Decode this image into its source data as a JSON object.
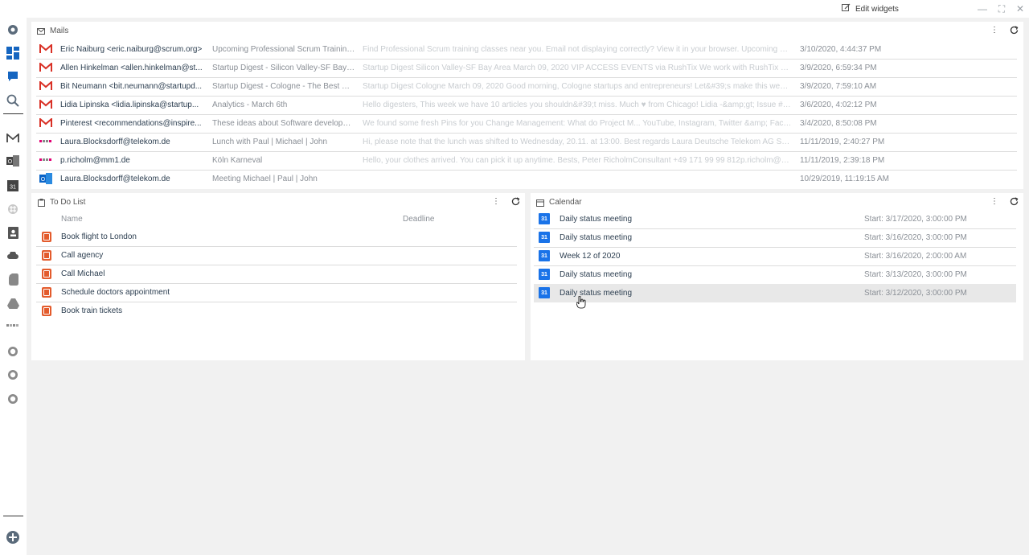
{
  "toolbar": {
    "edit_widgets_label": "Edit widgets"
  },
  "window": {
    "minimize": "—",
    "maximize": "⛶",
    "close": "✕"
  },
  "colors": {
    "accent": "#1565c0",
    "gmail_red": "#d93025",
    "todo_orange": "#e35b2c",
    "calendar_blue": "#1a73e8"
  },
  "sidebar": {
    "top_icons": [
      "gear-icon",
      "dashboard-icon",
      "chat-icon",
      "search-icon"
    ],
    "app_icons": [
      "gmail-icon",
      "outlook-icon",
      "calendar-icon",
      "slack-icon",
      "contacts-icon",
      "cloud-icon",
      "evernote-icon",
      "drive-icon",
      "telekom-icon",
      "whatsapp-icon",
      "whatsapp-icon",
      "whatsapp-icon"
    ],
    "add_icon": "add-icon"
  },
  "mails": {
    "title": "Mails",
    "rows": [
      {
        "icon": "gmail",
        "from": "Eric Naiburg <eric.naiburg@scrum.org>",
        "subject": "Upcoming Professional Scrum Training...",
        "preview": "Find Professional Scrum training classes near you. Email not displaying correctly? View it in your browser. Upcoming Prof...",
        "date": "3/10/2020, 4:44:37 PM"
      },
      {
        "icon": "gmail",
        "from": "Allen Hinkelman <allen.hinkelman@st...",
        "subject": "Startup Digest - Silicon Valley-SF Bay A...",
        "preview": "Startup Digest Silicon Valley-SF Bay Area March 09, 2020 VIP ACCESS EVENTS via RushTix We work with RushTix becau...",
        "date": "3/9/2020, 6:59:34 PM"
      },
      {
        "icon": "gmail",
        "from": "Bit Neumann <bit.neumann@startupd...",
        "subject": "Startup Digest - Cologne - The Best Dig...",
        "preview": "Startup Digest Cologne March 09, 2020 Good morning, Cologne startups and entrepreneurs! Let&#39;s make this week&#...",
        "date": "3/9/2020, 7:59:10 AM"
      },
      {
        "icon": "gmail",
        "from": "Lidia Lipinska <lidia.lipinska@startup...",
        "subject": "Analytics - March 6th",
        "preview": "Hello digesters, This week we have 10 articles you shouldn&#39;t miss. Much ♥ from Chicago! Lidia -&amp;gt; Issue #10...",
        "date": "3/6/2020, 4:02:12 PM"
      },
      {
        "icon": "gmail",
        "from": "Pinterest <recommendations@inspire...",
        "subject": "These ideas about Software developm...",
        "preview": "We found some fresh Pins for you Change Management: What do Project M... YouTube, Instagram, Twitter &amp; Facebo...",
        "date": "3/4/2020, 8:50:08 PM"
      },
      {
        "icon": "telekom",
        "from": "Laura.Blocksdorff@telekom.de",
        "subject": "Lunch with Paul | Michael | John",
        "preview": "Hi, please note that the lunch was shifted to Wednesday, 20.11. at 13:00. Best regards Laura Deutsche Telekom AG Start ...",
        "date": "11/11/2019, 2:40:27 PM"
      },
      {
        "icon": "telekom",
        "from": "p.richolm@mm1.de",
        "subject": "Köln Karneval",
        "preview": "Hello, your clothes arrived. You can pick it up anytime. Bests, Peter RicholmConsultant +49 171 99 99 812p.richolm@mm...",
        "date": "11/11/2019, 2:39:18 PM"
      },
      {
        "icon": "outlook",
        "from": "Laura.Blocksdorff@telekom.de",
        "subject": "Meeting Michael | Paul | John",
        "preview": "",
        "date": "10/29/2019, 11:19:15 AM"
      }
    ]
  },
  "todo": {
    "title": "To Do List",
    "col_name": "Name",
    "col_deadline": "Deadline",
    "items": [
      {
        "name": "Book flight to London"
      },
      {
        "name": "Call agency"
      },
      {
        "name": "Call Michael"
      },
      {
        "name": "Schedule doctors appointment"
      },
      {
        "name": "Book train tickets"
      }
    ]
  },
  "calendar": {
    "title": "Calendar",
    "badge": "31",
    "events": [
      {
        "title": "Daily status meeting",
        "start": "Start: 3/17/2020, 3:00:00 PM"
      },
      {
        "title": "Daily status meeting",
        "start": "Start: 3/16/2020, 3:00:00 PM"
      },
      {
        "title": "Week 12 of 2020",
        "start": "Start: 3/16/2020, 2:00:00 AM"
      },
      {
        "title": "Daily status meeting",
        "start": "Start: 3/13/2020, 3:00:00 PM"
      },
      {
        "title": "Daily status meeting",
        "start": "Start: 3/12/2020, 3:00:00 PM"
      }
    ]
  }
}
